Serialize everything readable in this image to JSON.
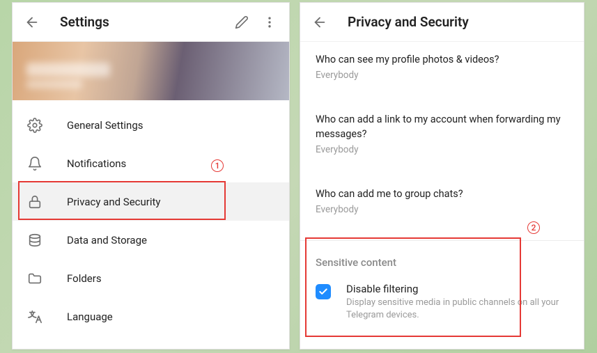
{
  "left": {
    "title": "Settings",
    "menu": [
      {
        "icon": "gear-icon",
        "label": "General Settings"
      },
      {
        "icon": "bell-icon",
        "label": "Notifications"
      },
      {
        "icon": "lock-icon",
        "label": "Privacy and Security"
      },
      {
        "icon": "disk-icon",
        "label": "Data and Storage"
      },
      {
        "icon": "folder-icon",
        "label": "Folders"
      },
      {
        "icon": "language-icon",
        "label": "Language"
      }
    ]
  },
  "right": {
    "title": "Privacy and Security",
    "privacy": [
      {
        "q": "Who can see my profile photos & videos?",
        "a": "Everybody"
      },
      {
        "q": "Who can add a link to my account when forwarding my messages?",
        "a": "Everybody"
      },
      {
        "q": "Who can add me to group chats?",
        "a": "Everybody"
      }
    ],
    "section_title": "Sensitive content",
    "disable_filtering": {
      "title": "Disable filtering",
      "sub": "Display sensitive media in public channels on all your Telegram devices.",
      "checked": true
    }
  },
  "annotations": {
    "num1": "1",
    "num2": "2"
  }
}
